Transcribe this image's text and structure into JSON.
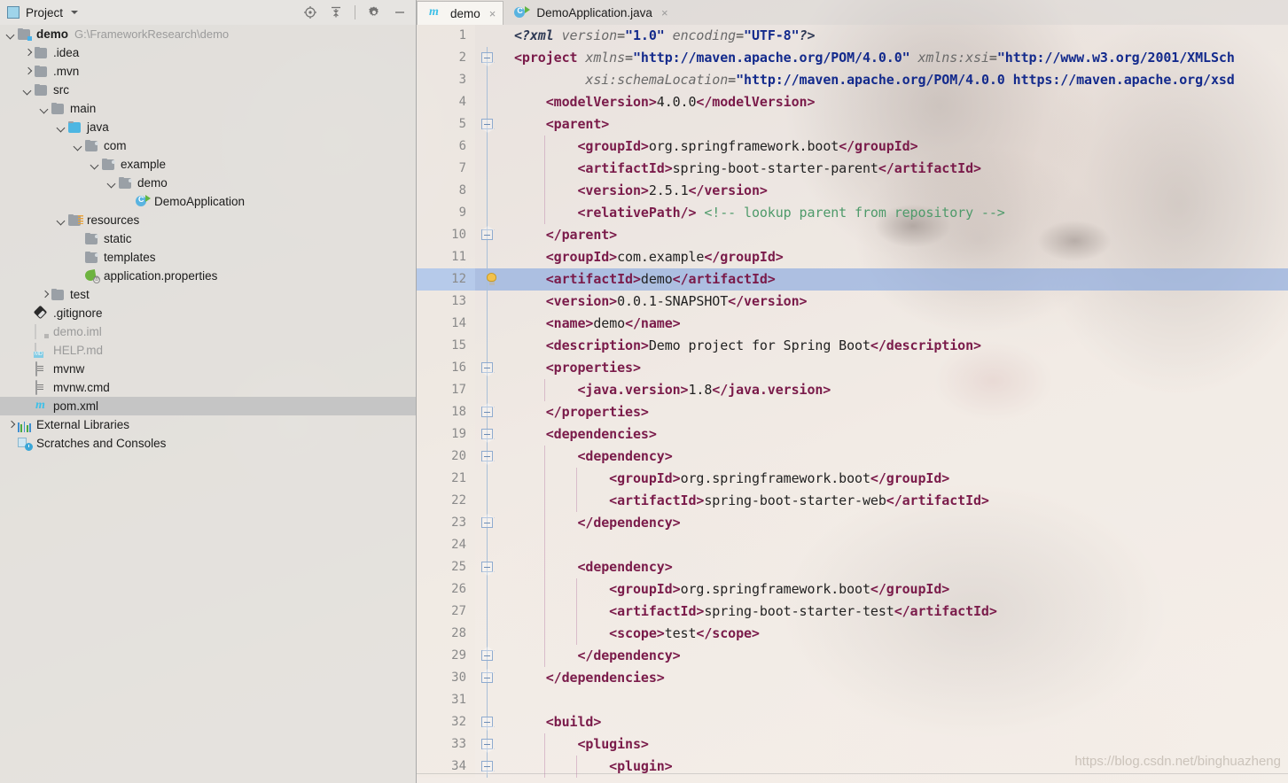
{
  "sidebar": {
    "panel_title": "Project",
    "tools": [
      {
        "name": "locate-icon",
        "label": "Select Opened File"
      },
      {
        "name": "collapse-all-icon",
        "label": "Collapse All"
      },
      {
        "name": "gear-icon",
        "label": "Settings"
      },
      {
        "name": "minimize-icon",
        "label": "Hide"
      }
    ],
    "tree": [
      {
        "label": "demo",
        "sub": "G:\\FrameworkResearch\\demo",
        "indent": 0,
        "arrow": "d",
        "icon": "folder-module",
        "bold": true,
        "dim": false,
        "selected": false
      },
      {
        "label": ".idea",
        "sub": "",
        "indent": 1,
        "arrow": "r",
        "icon": "folder",
        "bold": false,
        "dim": false,
        "selected": false
      },
      {
        "label": ".mvn",
        "sub": "",
        "indent": 1,
        "arrow": "r",
        "icon": "folder",
        "bold": false,
        "dim": false,
        "selected": false
      },
      {
        "label": "src",
        "sub": "",
        "indent": 1,
        "arrow": "d",
        "icon": "folder",
        "bold": false,
        "dim": false,
        "selected": false
      },
      {
        "label": "main",
        "sub": "",
        "indent": 2,
        "arrow": "d",
        "icon": "folder",
        "bold": false,
        "dim": false,
        "selected": false
      },
      {
        "label": "java",
        "sub": "",
        "indent": 3,
        "arrow": "d",
        "icon": "folder-source",
        "bold": false,
        "dim": false,
        "selected": false
      },
      {
        "label": "com",
        "sub": "",
        "indent": 4,
        "arrow": "d",
        "icon": "folder-package",
        "bold": false,
        "dim": false,
        "selected": false
      },
      {
        "label": "example",
        "sub": "",
        "indent": 5,
        "arrow": "d",
        "icon": "folder-package",
        "bold": false,
        "dim": false,
        "selected": false
      },
      {
        "label": "demo",
        "sub": "",
        "indent": 6,
        "arrow": "d",
        "icon": "folder-package",
        "bold": false,
        "dim": false,
        "selected": false
      },
      {
        "label": "DemoApplication",
        "sub": "",
        "indent": 7,
        "arrow": "none",
        "icon": "java-class-run",
        "bold": false,
        "dim": false,
        "selected": false
      },
      {
        "label": "resources",
        "sub": "",
        "indent": 3,
        "arrow": "d",
        "icon": "folder-resources",
        "bold": false,
        "dim": false,
        "selected": false
      },
      {
        "label": "static",
        "sub": "",
        "indent": 4,
        "arrow": "none",
        "icon": "folder-package",
        "bold": false,
        "dim": false,
        "selected": false
      },
      {
        "label": "templates",
        "sub": "",
        "indent": 4,
        "arrow": "none",
        "icon": "folder-package",
        "bold": false,
        "dim": false,
        "selected": false
      },
      {
        "label": "application.properties",
        "sub": "",
        "indent": 4,
        "arrow": "none",
        "icon": "spring-properties",
        "bold": false,
        "dim": false,
        "selected": false
      },
      {
        "label": "test",
        "sub": "",
        "indent": 2,
        "arrow": "r",
        "icon": "folder",
        "bold": false,
        "dim": false,
        "selected": false
      },
      {
        "label": ".gitignore",
        "sub": "",
        "indent": 1,
        "arrow": "none",
        "icon": "git-icon",
        "bold": false,
        "dim": false,
        "selected": false
      },
      {
        "label": "demo.iml",
        "sub": "",
        "indent": 1,
        "arrow": "none",
        "icon": "iml-file",
        "bold": false,
        "dim": true,
        "selected": false
      },
      {
        "label": "HELP.md",
        "sub": "",
        "indent": 1,
        "arrow": "none",
        "icon": "markdown-file",
        "bold": false,
        "dim": true,
        "selected": false
      },
      {
        "label": "mvnw",
        "sub": "",
        "indent": 1,
        "arrow": "none",
        "icon": "text-file",
        "bold": false,
        "dim": false,
        "selected": false
      },
      {
        "label": "mvnw.cmd",
        "sub": "",
        "indent": 1,
        "arrow": "none",
        "icon": "text-file",
        "bold": false,
        "dim": false,
        "selected": false
      },
      {
        "label": "pom.xml",
        "sub": "",
        "indent": 1,
        "arrow": "none",
        "icon": "maven-file",
        "bold": false,
        "dim": false,
        "selected": true
      },
      {
        "label": "External Libraries",
        "sub": "",
        "indent": 0,
        "arrow": "r",
        "icon": "libraries-icon",
        "bold": false,
        "dim": false,
        "selected": false
      },
      {
        "label": "Scratches and Consoles",
        "sub": "",
        "indent": 0,
        "arrow": "none",
        "icon": "scratches-icon",
        "bold": false,
        "dim": false,
        "selected": false
      }
    ]
  },
  "editor": {
    "tabs": [
      {
        "label": "demo",
        "icon": "maven-icon",
        "active": true,
        "closable": true
      },
      {
        "label": "DemoApplication.java",
        "icon": "java-class-run-icon",
        "active": false,
        "closable": true
      }
    ],
    "close_glyph": "×",
    "highlighted_line": 12,
    "bulb_line": 12,
    "lines": [
      {
        "n": 1,
        "fold": "",
        "indent": 0,
        "tokens": [
          {
            "t": "decl",
            "s": "<?xml "
          },
          {
            "t": "attr",
            "s": "version"
          },
          {
            "t": "eq",
            "s": "="
          },
          {
            "t": "val",
            "s": "\"1.0\""
          },
          {
            "t": "decl",
            "s": " "
          },
          {
            "t": "attr",
            "s": "encoding"
          },
          {
            "t": "eq",
            "s": "="
          },
          {
            "t": "val",
            "s": "\"UTF-8\""
          },
          {
            "t": "decl",
            "s": "?>"
          }
        ]
      },
      {
        "n": 2,
        "fold": "open",
        "indent": 0,
        "tokens": [
          {
            "t": "tag",
            "s": "<project "
          },
          {
            "t": "attr",
            "s": "xmlns"
          },
          {
            "t": "eq",
            "s": "="
          },
          {
            "t": "val",
            "s": "\"http://maven.apache.org/POM/4.0.0\""
          },
          {
            "t": "txt",
            "s": " "
          },
          {
            "t": "attr",
            "s": "xmlns:xsi"
          },
          {
            "t": "eq",
            "s": "="
          },
          {
            "t": "val",
            "s": "\"http://www.w3.org/2001/XMLSch"
          }
        ]
      },
      {
        "n": 3,
        "fold": "",
        "indent": 0,
        "tokens": [
          {
            "t": "txt",
            "s": "         "
          },
          {
            "t": "attr",
            "s": "xsi:schemaLocation"
          },
          {
            "t": "eq",
            "s": "="
          },
          {
            "t": "val",
            "s": "\"http://maven.apache.org/POM/4.0.0 https://maven.apache.org/xsd"
          }
        ]
      },
      {
        "n": 4,
        "fold": "",
        "indent": 0,
        "tokens": [
          {
            "t": "txt",
            "s": "    "
          },
          {
            "t": "tag",
            "s": "<modelVersion>"
          },
          {
            "t": "txt",
            "s": "4.0.0"
          },
          {
            "t": "tag",
            "s": "</modelVersion>"
          }
        ]
      },
      {
        "n": 5,
        "fold": "open",
        "indent": 0,
        "tokens": [
          {
            "t": "txt",
            "s": "    "
          },
          {
            "t": "tag",
            "s": "<parent>"
          }
        ]
      },
      {
        "n": 6,
        "fold": "",
        "indent": 1,
        "tokens": [
          {
            "t": "txt",
            "s": "        "
          },
          {
            "t": "tag",
            "s": "<groupId>"
          },
          {
            "t": "txt",
            "s": "org.springframework.boot"
          },
          {
            "t": "tag",
            "s": "</groupId>"
          }
        ]
      },
      {
        "n": 7,
        "fold": "",
        "indent": 1,
        "tokens": [
          {
            "t": "txt",
            "s": "        "
          },
          {
            "t": "tag",
            "s": "<artifactId>"
          },
          {
            "t": "txt",
            "s": "spring-boot-starter-parent"
          },
          {
            "t": "tag",
            "s": "</artifactId>"
          }
        ]
      },
      {
        "n": 8,
        "fold": "",
        "indent": 1,
        "tokens": [
          {
            "t": "txt",
            "s": "        "
          },
          {
            "t": "tag",
            "s": "<version>"
          },
          {
            "t": "txt",
            "s": "2.5.1"
          },
          {
            "t": "tag",
            "s": "</version>"
          }
        ]
      },
      {
        "n": 9,
        "fold": "",
        "indent": 1,
        "tokens": [
          {
            "t": "txt",
            "s": "        "
          },
          {
            "t": "tag",
            "s": "<relativePath/>"
          },
          {
            "t": "txt",
            "s": " "
          },
          {
            "t": "cmt",
            "s": "<!-- lookup parent from repository -->"
          }
        ]
      },
      {
        "n": 10,
        "fold": "close",
        "indent": 0,
        "tokens": [
          {
            "t": "txt",
            "s": "    "
          },
          {
            "t": "tag",
            "s": "</parent>"
          }
        ]
      },
      {
        "n": 11,
        "fold": "",
        "indent": 0,
        "tokens": [
          {
            "t": "txt",
            "s": "    "
          },
          {
            "t": "tag",
            "s": "<groupId>"
          },
          {
            "t": "txt",
            "s": "com.example"
          },
          {
            "t": "tag",
            "s": "</groupId>"
          }
        ]
      },
      {
        "n": 12,
        "fold": "",
        "indent": 0,
        "tokens": [
          {
            "t": "txt",
            "s": "    "
          },
          {
            "t": "tag",
            "s": "<artifactId>"
          },
          {
            "t": "txt",
            "s": "demo"
          },
          {
            "t": "tag",
            "s": "</artifactId>"
          }
        ]
      },
      {
        "n": 13,
        "fold": "",
        "indent": 0,
        "tokens": [
          {
            "t": "txt",
            "s": "    "
          },
          {
            "t": "tag",
            "s": "<version>"
          },
          {
            "t": "txt",
            "s": "0.0.1-SNAPSHOT"
          },
          {
            "t": "tag",
            "s": "</version>"
          }
        ]
      },
      {
        "n": 14,
        "fold": "",
        "indent": 0,
        "tokens": [
          {
            "t": "txt",
            "s": "    "
          },
          {
            "t": "tag",
            "s": "<name>"
          },
          {
            "t": "txt",
            "s": "demo"
          },
          {
            "t": "tag",
            "s": "</name>"
          }
        ]
      },
      {
        "n": 15,
        "fold": "",
        "indent": 0,
        "tokens": [
          {
            "t": "txt",
            "s": "    "
          },
          {
            "t": "tag",
            "s": "<description>"
          },
          {
            "t": "txt",
            "s": "Demo project for Spring Boot"
          },
          {
            "t": "tag",
            "s": "</description>"
          }
        ]
      },
      {
        "n": 16,
        "fold": "open",
        "indent": 0,
        "tokens": [
          {
            "t": "txt",
            "s": "    "
          },
          {
            "t": "tag",
            "s": "<properties>"
          }
        ]
      },
      {
        "n": 17,
        "fold": "",
        "indent": 1,
        "tokens": [
          {
            "t": "txt",
            "s": "        "
          },
          {
            "t": "tag",
            "s": "<java.version>"
          },
          {
            "t": "txt",
            "s": "1.8"
          },
          {
            "t": "tag",
            "s": "</java.version>"
          }
        ]
      },
      {
        "n": 18,
        "fold": "close",
        "indent": 0,
        "tokens": [
          {
            "t": "txt",
            "s": "    "
          },
          {
            "t": "tag",
            "s": "</properties>"
          }
        ]
      },
      {
        "n": 19,
        "fold": "open",
        "indent": 0,
        "tokens": [
          {
            "t": "txt",
            "s": "    "
          },
          {
            "t": "tag",
            "s": "<dependencies>"
          }
        ]
      },
      {
        "n": 20,
        "fold": "open",
        "indent": 1,
        "tokens": [
          {
            "t": "txt",
            "s": "        "
          },
          {
            "t": "tag",
            "s": "<dependency>"
          }
        ]
      },
      {
        "n": 21,
        "fold": "",
        "indent": 2,
        "tokens": [
          {
            "t": "txt",
            "s": "            "
          },
          {
            "t": "tag",
            "s": "<groupId>"
          },
          {
            "t": "txt",
            "s": "org.springframework.boot"
          },
          {
            "t": "tag",
            "s": "</groupId>"
          }
        ]
      },
      {
        "n": 22,
        "fold": "",
        "indent": 2,
        "tokens": [
          {
            "t": "txt",
            "s": "            "
          },
          {
            "t": "tag",
            "s": "<artifactId>"
          },
          {
            "t": "txt",
            "s": "spring-boot-starter-web"
          },
          {
            "t": "tag",
            "s": "</artifactId>"
          }
        ]
      },
      {
        "n": 23,
        "fold": "close",
        "indent": 1,
        "tokens": [
          {
            "t": "txt",
            "s": "        "
          },
          {
            "t": "tag",
            "s": "</dependency>"
          }
        ]
      },
      {
        "n": 24,
        "fold": "",
        "indent": 1,
        "tokens": []
      },
      {
        "n": 25,
        "fold": "open",
        "indent": 1,
        "tokens": [
          {
            "t": "txt",
            "s": "        "
          },
          {
            "t": "tag",
            "s": "<dependency>"
          }
        ]
      },
      {
        "n": 26,
        "fold": "",
        "indent": 2,
        "tokens": [
          {
            "t": "txt",
            "s": "            "
          },
          {
            "t": "tag",
            "s": "<groupId>"
          },
          {
            "t": "txt",
            "s": "org.springframework.boot"
          },
          {
            "t": "tag",
            "s": "</groupId>"
          }
        ]
      },
      {
        "n": 27,
        "fold": "",
        "indent": 2,
        "tokens": [
          {
            "t": "txt",
            "s": "            "
          },
          {
            "t": "tag",
            "s": "<artifactId>"
          },
          {
            "t": "txt",
            "s": "spring-boot-starter-test"
          },
          {
            "t": "tag",
            "s": "</artifactId>"
          }
        ]
      },
      {
        "n": 28,
        "fold": "",
        "indent": 2,
        "tokens": [
          {
            "t": "txt",
            "s": "            "
          },
          {
            "t": "tag",
            "s": "<scope>"
          },
          {
            "t": "txt",
            "s": "test"
          },
          {
            "t": "tag",
            "s": "</scope>"
          }
        ]
      },
      {
        "n": 29,
        "fold": "close",
        "indent": 1,
        "tokens": [
          {
            "t": "txt",
            "s": "        "
          },
          {
            "t": "tag",
            "s": "</dependency>"
          }
        ]
      },
      {
        "n": 30,
        "fold": "close",
        "indent": 0,
        "tokens": [
          {
            "t": "txt",
            "s": "    "
          },
          {
            "t": "tag",
            "s": "</dependencies>"
          }
        ]
      },
      {
        "n": 31,
        "fold": "",
        "indent": 0,
        "tokens": []
      },
      {
        "n": 32,
        "fold": "open",
        "indent": 0,
        "tokens": [
          {
            "t": "txt",
            "s": "    "
          },
          {
            "t": "tag",
            "s": "<build>"
          }
        ]
      },
      {
        "n": 33,
        "fold": "open",
        "indent": 1,
        "tokens": [
          {
            "t": "txt",
            "s": "        "
          },
          {
            "t": "tag",
            "s": "<plugins>"
          }
        ]
      },
      {
        "n": 34,
        "fold": "open",
        "indent": 2,
        "tokens": [
          {
            "t": "txt",
            "s": "            "
          },
          {
            "t": "tag",
            "s": "<plugin>"
          }
        ]
      }
    ]
  },
  "watermark": "https://blog.csdn.net/binghuazheng",
  "colors": {
    "tag": "#7a1b4a",
    "attribute": "#6a6a6a",
    "string_value": "#132a8c",
    "comment": "#4e9a6a",
    "selection": "#84a6e0",
    "tree_selection": "#c5c5c5"
  }
}
